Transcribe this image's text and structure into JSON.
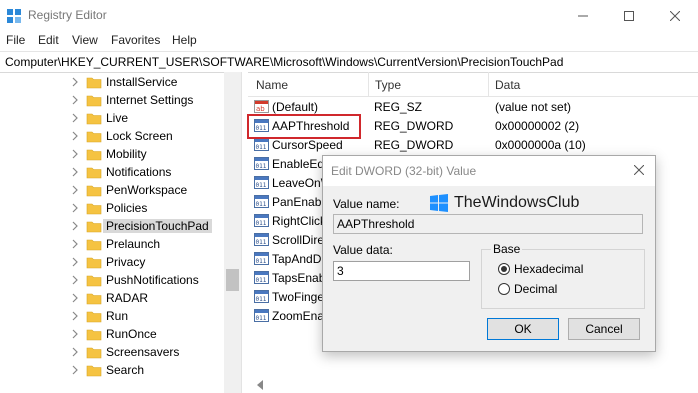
{
  "window": {
    "title": "Registry Editor"
  },
  "menu": [
    "File",
    "Edit",
    "View",
    "Favorites",
    "Help"
  ],
  "address": "Computer\\HKEY_CURRENT_USER\\SOFTWARE\\Microsoft\\Windows\\CurrentVersion\\PrecisionTouchPad",
  "tree": [
    {
      "label": "InstallService"
    },
    {
      "label": "Internet Settings"
    },
    {
      "label": "Live"
    },
    {
      "label": "Lock Screen"
    },
    {
      "label": "Mobility"
    },
    {
      "label": "Notifications"
    },
    {
      "label": "PenWorkspace"
    },
    {
      "label": "Policies"
    },
    {
      "label": "PrecisionTouchPad"
    },
    {
      "label": "Prelaunch"
    },
    {
      "label": "Privacy"
    },
    {
      "label": "PushNotifications"
    },
    {
      "label": "RADAR"
    },
    {
      "label": "Run"
    },
    {
      "label": "RunOnce"
    },
    {
      "label": "Screensavers"
    },
    {
      "label": "Search"
    }
  ],
  "columns": {
    "name": "Name",
    "type": "Type",
    "data": "Data"
  },
  "values": [
    {
      "name": "(Default)",
      "type": "REG_SZ",
      "data": "(value not set)",
      "icon": "string-value-icon"
    },
    {
      "name": "AAPThreshold",
      "type": "REG_DWORD",
      "data": "0x00000002 (2)",
      "icon": "dword-value-icon"
    },
    {
      "name": "CursorSpeed",
      "type": "REG_DWORD",
      "data": "0x0000000a (10)",
      "icon": "dword-value-icon"
    },
    {
      "name": "EnableEdg",
      "type": "",
      "data": "",
      "icon": "dword-value-icon"
    },
    {
      "name": "LeaveOnW",
      "type": "",
      "data": "",
      "icon": "dword-value-icon"
    },
    {
      "name": "PanEnable",
      "type": "",
      "data": "",
      "icon": "dword-value-icon"
    },
    {
      "name": "RightClick",
      "type": "",
      "data": "",
      "icon": "dword-value-icon"
    },
    {
      "name": "ScrollDire",
      "type": "",
      "data": "",
      "icon": "dword-value-icon"
    },
    {
      "name": "TapAndDr",
      "type": "",
      "data": "",
      "icon": "dword-value-icon"
    },
    {
      "name": "TapsEnabl",
      "type": "",
      "data": "",
      "icon": "dword-value-icon"
    },
    {
      "name": "TwoFinger",
      "type": "",
      "data": "",
      "icon": "dword-value-icon"
    },
    {
      "name": "ZoomEna",
      "type": "",
      "data": "",
      "icon": "dword-value-icon"
    }
  ],
  "dialog": {
    "title": "Edit DWORD (32-bit) Value",
    "value_name_label": "Value name:",
    "value_name": "AAPThreshold",
    "value_data_label": "Value data:",
    "value_data": "3",
    "base_label": "Base",
    "hex_label": "Hexadecimal",
    "dec_label": "Decimal",
    "ok_label": "OK",
    "cancel_label": "Cancel",
    "watermark": "TheWindowsClub"
  },
  "colors": {
    "highlight": "#d0282c",
    "accent": "#0078d7",
    "folder": "#f5c342"
  }
}
